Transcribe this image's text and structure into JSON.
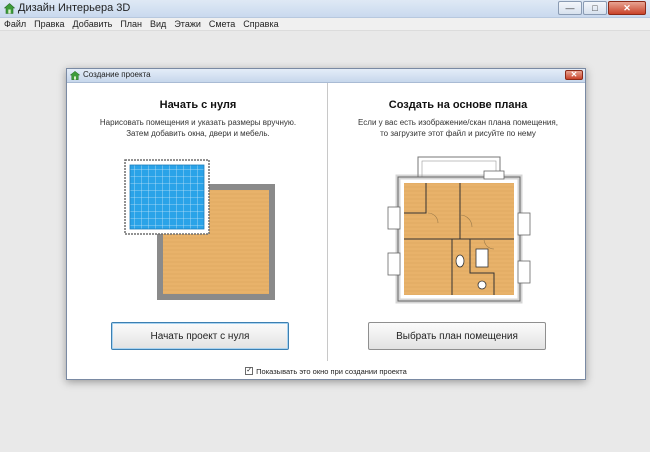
{
  "window": {
    "title": "Дизайн Интерьера 3D",
    "buttons": {
      "minimize": "—",
      "maximize": "□",
      "close": "✕"
    }
  },
  "menu": {
    "items": [
      "Файл",
      "Правка",
      "Добавить",
      "План",
      "Вид",
      "Этажи",
      "Смета",
      "Справка"
    ]
  },
  "dialog": {
    "title": "Создание проекта",
    "close_symbol": "✕",
    "left": {
      "heading": "Начать с нуля",
      "description": [
        "Нарисовать помещения и указать размеры вручную.",
        "Затем добавить окна, двери и мебель."
      ],
      "button": "Начать проект с нуля"
    },
    "right": {
      "heading": "Создать на основе плана",
      "description": [
        "Если у вас есть изображение/скан плана помещения,",
        "то загрузите этот файл и рисуйте по нему"
      ],
      "button": "Выбрать план помещения"
    },
    "footer": {
      "checkbox_checked": true,
      "checkbox_mark": "✓",
      "checkbox_label": "Показывать это окно при создании проекта"
    }
  },
  "colors": {
    "floor_orange": "#e8b26a",
    "blueprint_blue": "#2aa3e8",
    "wall_gray": "#6e6e6e"
  }
}
